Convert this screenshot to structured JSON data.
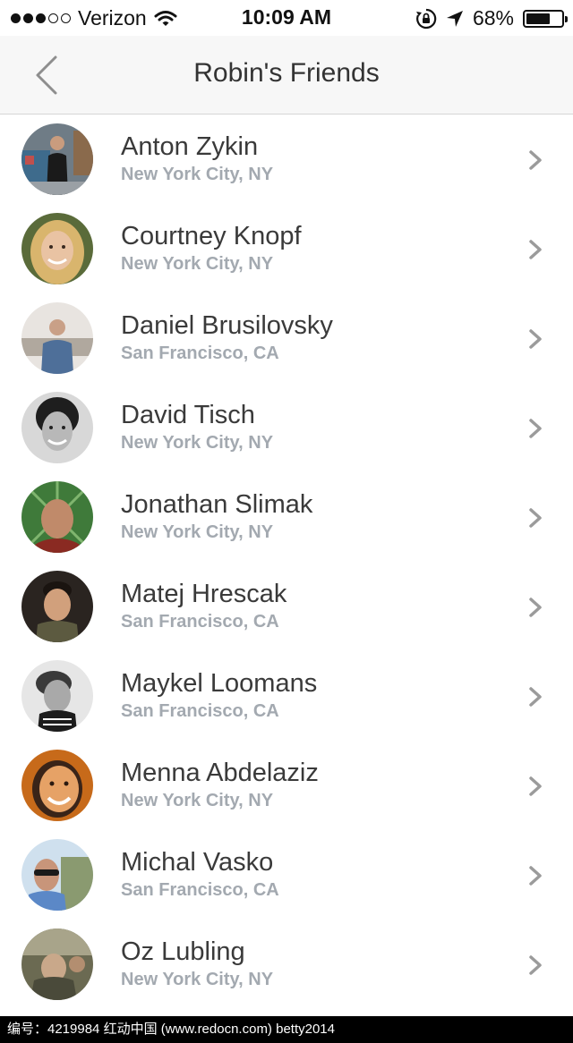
{
  "status_bar": {
    "carrier": "Verizon",
    "time": "10:09 AM",
    "battery": "68%",
    "battery_level": 0.68,
    "signal_filled": 3,
    "signal_total": 5
  },
  "nav": {
    "title": "Robin's Friends",
    "back_icon": "chevron-left-icon"
  },
  "friends": [
    {
      "name": "Anton Zykin",
      "location": "New York City, NY"
    },
    {
      "name": "Courtney Knopf",
      "location": "New York City, NY"
    },
    {
      "name": "Daniel Brusilovsky",
      "location": "San Francisco, CA"
    },
    {
      "name": "David Tisch",
      "location": "New York City, NY"
    },
    {
      "name": "Jonathan Slimak",
      "location": "New York City, NY"
    },
    {
      "name": "Matej Hrescak",
      "location": "San Francisco, CA"
    },
    {
      "name": "Maykel Loomans",
      "location": "San Francisco, CA"
    },
    {
      "name": "Menna Abdelaziz",
      "location": "New York City, NY"
    },
    {
      "name": "Michal Vasko",
      "location": "San Francisco, CA"
    },
    {
      "name": "Oz Lubling",
      "location": "New York City, NY"
    }
  ],
  "footer": {
    "text": "编号：4219984    红动中国 (www.redocn.com)    betty2014"
  },
  "colors": {
    "name": "#3a3a3a",
    "location": "#a3a9b0",
    "chevron": "#9b9b9b",
    "nav_background": "#f7f7f7"
  }
}
